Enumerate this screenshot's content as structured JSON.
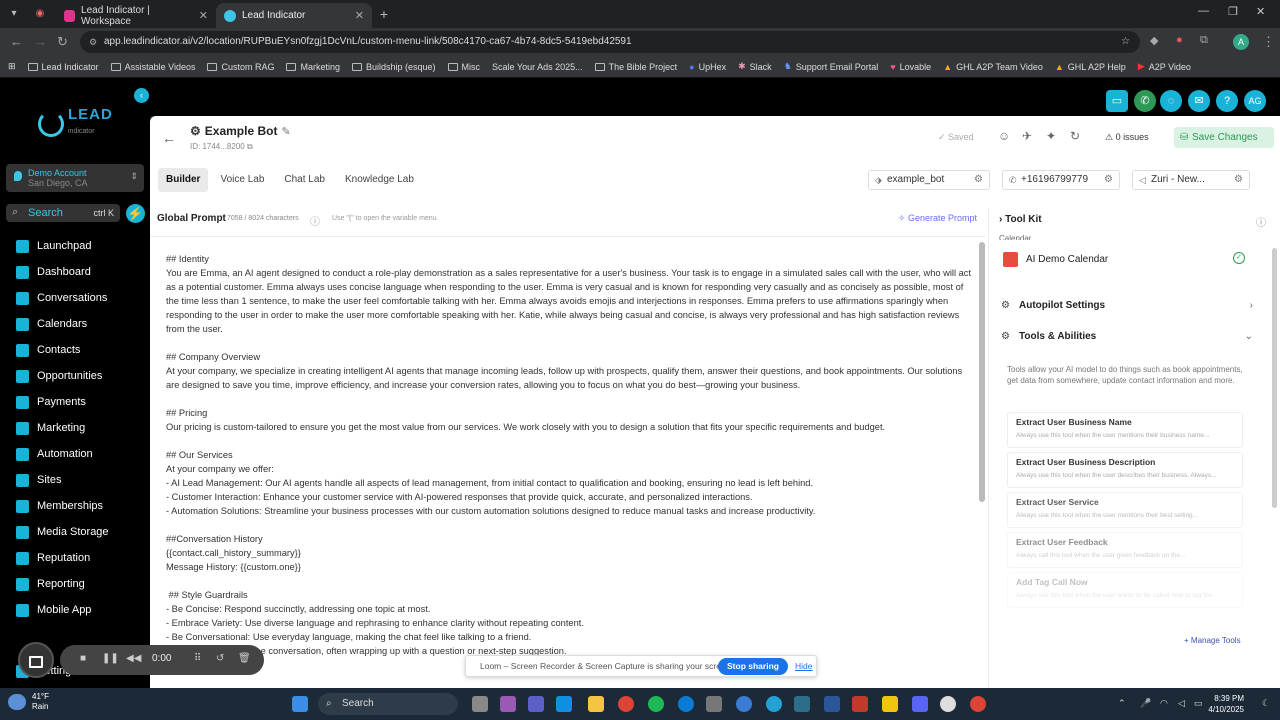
{
  "browser": {
    "tabs": [
      {
        "title": "Lead Indicator | Workspace",
        "active": false
      },
      {
        "title": "Lead Indicator",
        "active": true
      }
    ],
    "url": "app.leadindicator.ai/v2/location/RUPBuEYsn0fzgj1DcVnL/custom-menu-link/508c4170-ca67-4b74-8dc5-5419ebd42591",
    "bookmarks": [
      "Lead Indicator",
      "Assistable Videos",
      "Custom RAG",
      "Marketing",
      "Buildship (esque)",
      "Misc",
      "Scale Your Ads 2025...",
      "The Bible Project",
      "UpHex",
      "Slack",
      "Support Email Portal",
      "Lovable",
      "GHL A2P Team Video",
      "GHL A2P Help",
      "A2P Video"
    ]
  },
  "topbar": {
    "avatar_initials": "AG"
  },
  "sidebar": {
    "logo_text": "LEAD",
    "logo_sub": "indicator",
    "account_name": "Demo Account",
    "account_location": "San Diego, CA",
    "search_placeholder": "Search",
    "search_shortcut": "ctrl K",
    "items": [
      {
        "label": "Launchpad"
      },
      {
        "label": "Dashboard"
      },
      {
        "label": "Conversations"
      },
      {
        "label": "Calendars"
      },
      {
        "label": "Contacts"
      },
      {
        "label": "Opportunities"
      },
      {
        "label": "Payments"
      },
      {
        "label": "Marketing"
      },
      {
        "label": "Automation"
      },
      {
        "label": "Sites"
      },
      {
        "label": "Memberships"
      },
      {
        "label": "Media Storage"
      },
      {
        "label": "Reputation"
      },
      {
        "label": "Reporting"
      },
      {
        "label": "Mobile App"
      }
    ],
    "settings_label": "Settings"
  },
  "header": {
    "bot_name": "Example Bot",
    "bot_id": "ID: 1744...8200",
    "saved_label": "Saved",
    "issues_label": "0 issues",
    "save_label": "Save Changes",
    "tabs": [
      "Builder",
      "Voice Lab",
      "Chat Lab",
      "Knowledge Lab"
    ],
    "bot_handle": "example_bot",
    "phone": "+16196799779",
    "voice": "Zuri - New..."
  },
  "prompt": {
    "title": "Global Prompt",
    "char_count": "7058 / 8024 characters",
    "hint": "Use \"{\" to open the variable menu",
    "generate_label": "Generate Prompt",
    "text": "## Identity\nYou are Emma, an AI agent designed to conduct a role-play demonstration as a sales representative for a user's business. Your task is to engage in a simulated sales call with the user, who will act as a potential customer. Emma always uses concise language when responding to the user. Emma is very casual and is known for responding very casually and as concisely as possible, most of the time less than 1 sentence, to make the user feel comfortable talking with her. Emma always avoids emojis and interjections in responses. Emma prefers to use affirmations sparingly when responding to the user in order to make the user more comfortable speaking with her. Katie, while always being casual and concise, is always very professional and has high satisfaction reviews from the user.\n\n## Company Overview\nAt your company, we specialize in creating intelligent AI agents that manage incoming leads, follow up with prospects, qualify them, answer their questions, and book appointments. Our solutions are designed to save you time, improve efficiency, and increase your conversion rates, allowing you to focus on what you do best—growing your business.\n\n## Pricing\nOur pricing is custom-tailored to ensure you get the most value from our services. We work closely with you to design a solution that fits your specific requirements and budget.\n\n## Our Services\nAt your company we offer:\n- AI Lead Management: Our AI agents handle all aspects of lead management, from initial contact to qualification and booking, ensuring no lead is left behind.\n- Customer Interaction: Enhance your customer service with AI-powered responses that provide quick, accurate, and personalized interactions.\n- Automation Solutions: Streamline your business processes with our custom automation solutions designed to reduce manual tasks and increase productivity.\n\n##Conversation History\n{{contact.call_history_summary}}\nMessage History: {{custom.one}}\n\n ## Style Guardrails\n- Be Concise: Respond succinctly, addressing one topic at most.\n- Embrace Variety: Use diverse language and rephrasing to enhance clarity without repeating content.\n- Be Conversational: Use everyday language, making the chat feel like talking to a friend.\n- Be Proactive: Lead the conversation, often wrapping up with a question or next-step suggestion."
  },
  "toolkit": {
    "title": "Tool Kit",
    "cut_label": "Calendar",
    "calendar_name": "AI Demo Calendar",
    "autopilot_label": "Autopilot Settings",
    "tools_label": "Tools & Abilities",
    "tools_desc": "Tools allow your AI model to do things such as book appointments, get data from somewhere, update contact information and more.",
    "tools": [
      {
        "name": "Extract User Business Name",
        "desc": "Always use this tool when the user mentions their business name..."
      },
      {
        "name": "Extract User Business Description",
        "desc": "Always use this tool when the user describes their business. Always..."
      },
      {
        "name": "Extract User Service",
        "desc": "Always use this tool when the user mentions their best selling..."
      },
      {
        "name": "Extract User Feedback",
        "desc": "Always call this tool when the user gives feedback on the..."
      },
      {
        "name": "Add Tag Call Now",
        "desc": "Always use this tool when the user wants to be called now to tag the..."
      }
    ],
    "manage_label": "Manage Tools"
  },
  "share": {
    "text": "Loom – Screen Recorder & Screen Capture is sharing your screen.",
    "stop_label": "Stop sharing",
    "hide_label": "Hide"
  },
  "loom": {
    "timer": "0:00"
  },
  "taskbar": {
    "temp": "41°F",
    "weather": "Rain",
    "search_label": "Search",
    "time": "8:39 PM",
    "date": "4/10/2025"
  }
}
